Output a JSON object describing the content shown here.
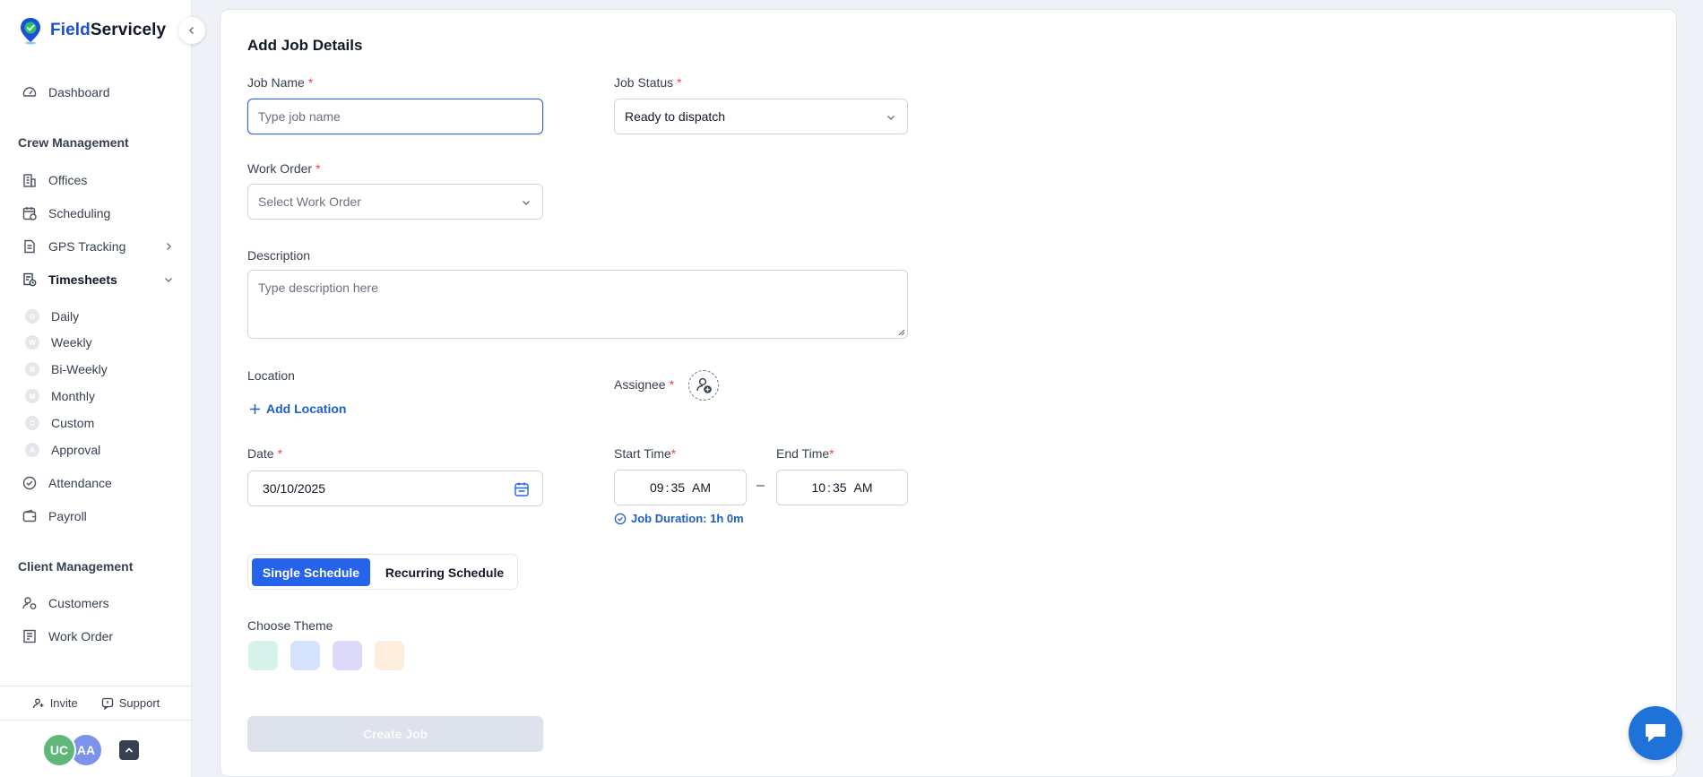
{
  "app": {
    "brand_part1": "Field",
    "brand_part2": "Servicely"
  },
  "sidebar": {
    "dashboard": "Dashboard",
    "crew_section": "Crew Management",
    "offices": "Offices",
    "scheduling": "Scheduling",
    "gps_tracking": "GPS Tracking",
    "timesheets": "Timesheets",
    "timesheet_items": [
      {
        "label": "Daily",
        "letter": "D"
      },
      {
        "label": "Weekly",
        "letter": "W"
      },
      {
        "label": "Bi-Weekly",
        "letter": "B"
      },
      {
        "label": "Monthly",
        "letter": "M"
      },
      {
        "label": "Custom",
        "letter": "C"
      },
      {
        "label": "Approval",
        "letter": "A"
      }
    ],
    "attendance": "Attendance",
    "payroll": "Payroll",
    "client_section": "Client Management",
    "customers": "Customers",
    "work_order": "Work Order",
    "invite": "Invite",
    "support": "Support",
    "avatars": [
      {
        "initials": "UC",
        "color": "#5fb87a"
      },
      {
        "initials": "AA",
        "color": "#7b93ea"
      }
    ]
  },
  "form": {
    "title": "Add Job Details",
    "job_name_label": "Job Name",
    "job_name_placeholder": "Type job name",
    "job_status_label": "Job Status",
    "job_status_value": "Ready to dispatch",
    "work_order_label": "Work Order",
    "work_order_placeholder": "Select Work Order",
    "description_label": "Description",
    "description_placeholder": "Type description here",
    "location_label": "Location",
    "add_location": "Add Location",
    "assignee_label": "Assignee",
    "date_label": "Date",
    "date_value": "30/10/2025",
    "start_time_label": "Start Time",
    "start_hour": "09",
    "start_minute": "35",
    "start_period": "AM",
    "end_time_label": "End Time",
    "end_hour": "10",
    "end_minute": "35",
    "end_period": "AM",
    "time_separator": ":",
    "range_separator": "–",
    "duration": "Job Duration: 1h 0m",
    "single_schedule": "Single Schedule",
    "recurring_schedule": "Recurring Schedule",
    "theme_label": "Choose Theme",
    "theme_colors": [
      "#d5f3ea",
      "#d4e3fb",
      "#dcd9fa",
      "#fdeedd"
    ],
    "create_button": "Create Job",
    "required_mark": "*"
  },
  "colors": {
    "accent": "#2563eb",
    "link": "#1d5fc6",
    "required": "#ef4444"
  }
}
